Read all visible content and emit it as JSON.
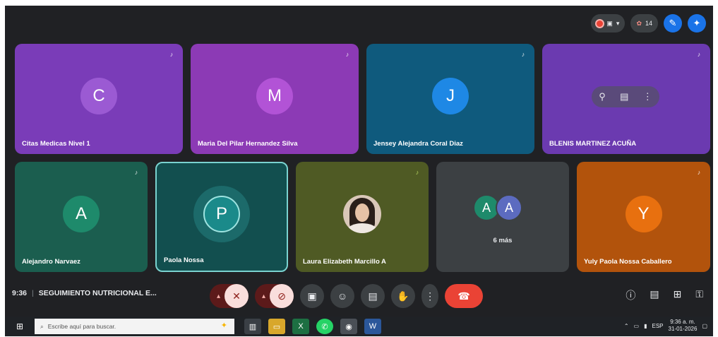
{
  "topbar": {
    "participants_count": "14",
    "rec_icon": "record-icon",
    "camera_icon": "camera-icon",
    "people_icon": "people-icon",
    "account_icon": "account-icon"
  },
  "tiles_row1": [
    {
      "initial": "C",
      "name": "Citas Medicas Nivel 1",
      "bg": "#7a3cb8",
      "avatar": "#9b5ad3"
    },
    {
      "initial": "M",
      "name": "Maria Del Pilar Hernandez Silva",
      "bg": "#8c3ab5",
      "avatar": "#b253d6"
    },
    {
      "initial": "J",
      "name": "Jensey Alejandra Coral Diaz",
      "bg": "#0f5a7d",
      "avatar": "#1e88e5"
    },
    {
      "initial": "",
      "name": "BLENIS MARTINEZ ACUÑA",
      "bg": "#6b3ab0",
      "avatar": ""
    }
  ],
  "tiles_row2": [
    {
      "initial": "A",
      "name": "Alejandro Narvaez",
      "bg": "#1b5e4f",
      "avatar": "#1e8a6b"
    },
    {
      "initial": "P",
      "name": "Paola Nossa",
      "bg": "#124f4f",
      "avatar": "#1a8a8a"
    },
    {
      "initial": "",
      "name": "Laura Elizabeth Marcillo A",
      "bg": "#4f5a24",
      "avatar": ""
    },
    {
      "initial": "",
      "name": "",
      "bg": "#3c4043",
      "avatar": ""
    },
    {
      "initial": "Y",
      "name": "Yuly Paola Nossa Caballero",
      "bg": "#b2530c",
      "avatar": "#e8700f"
    }
  ],
  "more": {
    "a1": "A",
    "a2": "A",
    "label": "6 más"
  },
  "meeting": {
    "time": "9:36",
    "title": "SEGUIMIENTO NUTRICIONAL E..."
  },
  "taskbar": {
    "search_placeholder": "Escribe aquí para buscar.",
    "clock_time": "9:36 a. m.",
    "clock_date": "31-01-2026",
    "lang": "ESP"
  },
  "colors": {
    "meet_bg": "#202124",
    "hangup": "#ea4335",
    "accent": "#8ab4f8"
  }
}
